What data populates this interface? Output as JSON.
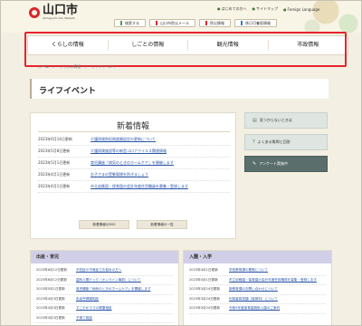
{
  "header": {
    "logo_name": "山口市",
    "logo_sub": "Yamaguchi City Website",
    "buttons": {
      "search": "検索する",
      "mail": "山口市防災メール",
      "disaster": "防災情報",
      "emergency": "休日可養医情報"
    },
    "links": {
      "first_time": "はじめての方へ",
      "sitemap": "サイトマップ",
      "foreign": "Foreign Language"
    }
  },
  "gnav": {
    "items": [
      "くらしの情報",
      "しごとの情報",
      "観光情報",
      "市政情報"
    ]
  },
  "breadcrumb": {
    "items": [
      "ホーム",
      ">",
      "くらしの情報",
      ">",
      "ライフイベント"
    ]
  },
  "page": {
    "title": "ライフイベント"
  },
  "news": {
    "title": "新着情報",
    "items": [
      {
        "date": "2023年6月14日更新",
        "text": "介護保険負担限度額認定の更新について"
      },
      {
        "date": "2023年5月8日更新",
        "text": "介護保険施設等の新型コロナウイルス関連情報"
      },
      {
        "date": "2023年5月1日更新",
        "text": "育児講座「病気のときのホームケア」を開催します"
      },
      {
        "date": "2023年4月1日更新",
        "text": "お子さまの受動喫煙を防ぎましょう"
      },
      {
        "date": "2023年4月1日更新",
        "text": "市立幼稚園・保育園の会計年度任用職員を募集・登録します"
      }
    ],
    "rss_button": "新着情報のRSS",
    "list_button": "新着情報の一覧"
  },
  "side": {
    "not_found": "見つからないときは",
    "faq": "よくある質問と回答",
    "survey": "アンケート実施中"
  },
  "cat_left": {
    "title": "出産・育児",
    "items": [
      {
        "date": "2023年6月12日更新",
        "text": "不妊症や不育症でお悩みの方へ"
      },
      {
        "date": "2023年6月12日更新",
        "text": "歯科人間ドック（オンライン事前）について"
      },
      {
        "date": "2023年5月1日更新",
        "text": "育児講座「病気のときのホームケア」を開催します"
      },
      {
        "date": "2023年4月3日更新",
        "text": "乳幼児健康相談"
      },
      {
        "date": "2023年4月3日更新",
        "text": "すこやかママの健康相談"
      },
      {
        "date": "2023年4月3日更新",
        "text": "子育て相談"
      }
    ]
  },
  "cat_right": {
    "title": "入園・入学",
    "items": [
      {
        "date": "2023年4月1日更新",
        "text": "学校教育課の業務について"
      },
      {
        "date": "2023年4月1日更新",
        "text": "市立幼稚園・保育園の会計年度任用職員を募集・登録します"
      },
      {
        "date": "2023年3月24日更新",
        "text": "新教育課のお問い合わせについて"
      },
      {
        "date": "2023年3月24日更新",
        "text": "利用者負担額（保育料）について"
      },
      {
        "date": "2023年3月24日更新",
        "text": "令和5年度保育園施設入園のご案内"
      }
    ]
  }
}
